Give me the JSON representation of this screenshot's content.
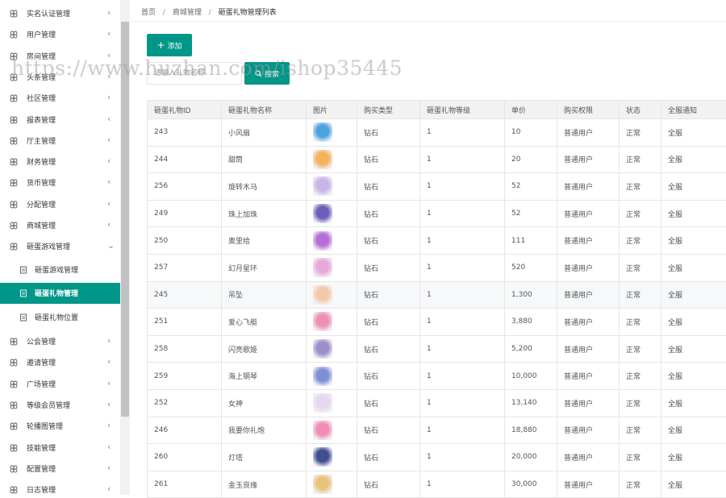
{
  "sidebar": {
    "items": [
      {
        "label": "实名认证管理",
        "chevron": "‹"
      },
      {
        "label": "用户管理",
        "chevron": "‹"
      },
      {
        "label": "房间管理",
        "chevron": "‹"
      },
      {
        "label": "头条管理",
        "chevron": "‹"
      },
      {
        "label": "社区管理",
        "chevron": "‹"
      },
      {
        "label": "报表管理",
        "chevron": "‹"
      },
      {
        "label": "厅主管理",
        "chevron": "‹"
      },
      {
        "label": "财务管理",
        "chevron": "‹"
      },
      {
        "label": "货币管理",
        "chevron": "‹"
      },
      {
        "label": "分配管理",
        "chevron": "‹"
      },
      {
        "label": "商城管理",
        "chevron": "‹"
      },
      {
        "label": "砸蛋游戏管理",
        "chevron": "⌄"
      }
    ],
    "subitems": [
      {
        "label": "砸蛋游戏管理"
      },
      {
        "label": "砸蛋礼物管理"
      },
      {
        "label": "砸蛋礼物位置"
      }
    ],
    "items_after": [
      {
        "label": "公会管理",
        "chevron": "‹"
      },
      {
        "label": "邀请管理",
        "chevron": "‹"
      },
      {
        "label": "广场管理",
        "chevron": "‹"
      },
      {
        "label": "等级会员管理",
        "chevron": "‹"
      },
      {
        "label": "轮播图管理",
        "chevron": "‹"
      },
      {
        "label": "技能管理",
        "chevron": "‹"
      },
      {
        "label": "配置管理",
        "chevron": "‹"
      },
      {
        "label": "日志管理",
        "chevron": "‹"
      }
    ]
  },
  "breadcrumb": {
    "home": "首页",
    "sep": "/",
    "level1": "商城管理",
    "current": "砸蛋礼物管理列表"
  },
  "toolbar": {
    "add_label": "添加",
    "search_placeholder": "请输入礼物名称",
    "search_label": "搜索"
  },
  "watermark": "https://www.huzhan.com/ishop35445",
  "table": {
    "headers": [
      "砸蛋礼物ID",
      "砸蛋礼物名称",
      "图片",
      "购买类型",
      "砸蛋礼物等级",
      "单价",
      "购买权限",
      "状态",
      "全服通知"
    ],
    "rows": [
      {
        "id": "243",
        "name": "小风扇",
        "type": "钻石",
        "level": "1",
        "price": "10",
        "perm": "普通用户",
        "status": "正常",
        "notify": "全服",
        "img": "#4aa3df"
      },
      {
        "id": "244",
        "name": "甜筒",
        "type": "钻石",
        "level": "1",
        "price": "20",
        "perm": "普通用户",
        "status": "正常",
        "notify": "全服",
        "img": "#f3b35a"
      },
      {
        "id": "256",
        "name": "旋转木马",
        "type": "钻石",
        "level": "1",
        "price": "52",
        "perm": "普通用户",
        "status": "正常",
        "notify": "全服",
        "img": "#c9b4e6"
      },
      {
        "id": "249",
        "name": "珠上加珠",
        "type": "钻石",
        "level": "1",
        "price": "52",
        "perm": "普通用户",
        "status": "正常",
        "notify": "全服",
        "img": "#6a5fb8"
      },
      {
        "id": "250",
        "name": "奥里给",
        "type": "钻石",
        "level": "1",
        "price": "111",
        "perm": "普通用户",
        "status": "正常",
        "notify": "全服",
        "img": "#b36fd6"
      },
      {
        "id": "257",
        "name": "幻月星环",
        "type": "钻石",
        "level": "1",
        "price": "520",
        "perm": "普通用户",
        "status": "正常",
        "notify": "全服",
        "img": "#e8a8d8"
      },
      {
        "id": "245",
        "name": "吊坠",
        "type": "钻石",
        "level": "1",
        "price": "1,300",
        "perm": "普通用户",
        "status": "正常",
        "notify": "全服",
        "img": "#f2c9a8"
      },
      {
        "id": "251",
        "name": "爱心飞艇",
        "type": "钻石",
        "level": "1",
        "price": "3,880",
        "perm": "普通用户",
        "status": "正常",
        "notify": "全服",
        "img": "#ef8fb6"
      },
      {
        "id": "258",
        "name": "闪亮歌姬",
        "type": "钻石",
        "level": "1",
        "price": "5,200",
        "perm": "普通用户",
        "status": "正常",
        "notify": "全服",
        "img": "#9b8ec9"
      },
      {
        "id": "259",
        "name": "海上钢琴",
        "type": "钻石",
        "level": "1",
        "price": "10,000",
        "perm": "普通用户",
        "status": "正常",
        "notify": "全服",
        "img": "#7f8fd6"
      },
      {
        "id": "252",
        "name": "女神",
        "type": "钻石",
        "level": "1",
        "price": "13,140",
        "perm": "普通用户",
        "status": "正常",
        "notify": "全服",
        "img": "#e4d8ee"
      },
      {
        "id": "246",
        "name": "我要你礼炮",
        "type": "钻石",
        "level": "1",
        "price": "18,880",
        "perm": "普通用户",
        "status": "正常",
        "notify": "全服",
        "img": "#f08cb6"
      },
      {
        "id": "260",
        "name": "灯塔",
        "type": "钻石",
        "level": "1",
        "price": "20,000",
        "perm": "普通用户",
        "status": "正常",
        "notify": "全服",
        "img": "#3f4f8f"
      },
      {
        "id": "261",
        "name": "金玉良缘",
        "type": "钻石",
        "level": "1",
        "price": "30,000",
        "perm": "普通用户",
        "status": "正常",
        "notify": "全服",
        "img": "#e9c27a"
      }
    ]
  },
  "colors": {
    "accent": "#009688",
    "header_bg": "#f2f2f2",
    "border": "#e6e6e6"
  }
}
